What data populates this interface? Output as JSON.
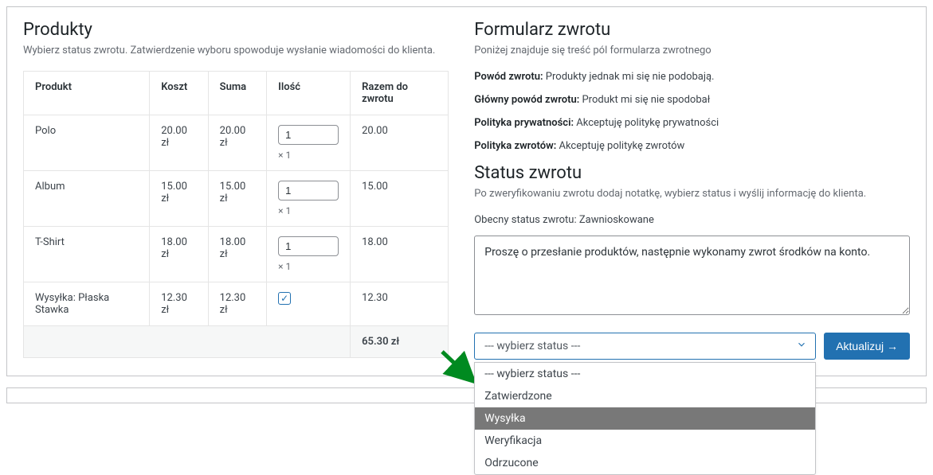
{
  "left": {
    "title": "Produkty",
    "subtitle": "Wybierz status zwrotu. Zatwierdzenie wyboru spowoduje wysłanie wiadomości do klienta.",
    "headers": {
      "product": "Produkt",
      "cost": "Koszt",
      "sum": "Suma",
      "qty": "Ilość",
      "total": "Razem do zwrotu"
    },
    "rows": [
      {
        "product": "Polo",
        "cost": "20.00 zł",
        "sum": "20.00 zł",
        "qty": "1",
        "mult": "× 1",
        "total": "20.00"
      },
      {
        "product": "Album",
        "cost": "15.00 zł",
        "sum": "15.00 zł",
        "qty": "1",
        "mult": "× 1",
        "total": "15.00"
      },
      {
        "product": "T-Shirt",
        "cost": "18.00 zł",
        "sum": "18.00 zł",
        "qty": "1",
        "mult": "× 1",
        "total": "18.00"
      },
      {
        "product": "Wysyłka: Płaska Stawka",
        "cost": "12.30 zł",
        "sum": "12.30 zł",
        "shipping_checked": true,
        "total": "12.30"
      }
    ],
    "grand_total": "65.30 zł"
  },
  "right": {
    "form_title": "Formularz zwrotu",
    "form_subtitle": "Poniżej znajduje się treść pól formularza zwrotnego",
    "fields": [
      {
        "label": "Powód zwrotu:",
        "value": "Produkty jednak mi się nie podobają."
      },
      {
        "label": "Główny powód zwrotu:",
        "value": "Produkt mi się nie spodobał"
      },
      {
        "label": "Polityka prywatności:",
        "value": "Akceptuję politykę prywatności"
      },
      {
        "label": "Polityka zwrotów:",
        "value": "Akceptuję politykę zwrotów"
      }
    ],
    "status_title": "Status zwrotu",
    "status_subtitle": "Po zweryfikowaniu zwrotu dodaj notatkę, wybierz status i wyślij informację do klienta.",
    "current_status_label": "Obecny status zwrotu:",
    "current_status_value": "Zawnioskowane",
    "note": "Proszę o przesłanie produktów, następnie wykonamy zwrot środków na konto.",
    "select_placeholder": "--- wybierz status ---",
    "options": [
      "--- wybierz status ---",
      "Zatwierdzone",
      "Wysyłka",
      "Weryfikacja",
      "Odrzucone"
    ],
    "hovered_option_index": 2,
    "update_button": "Aktualizuj →"
  }
}
